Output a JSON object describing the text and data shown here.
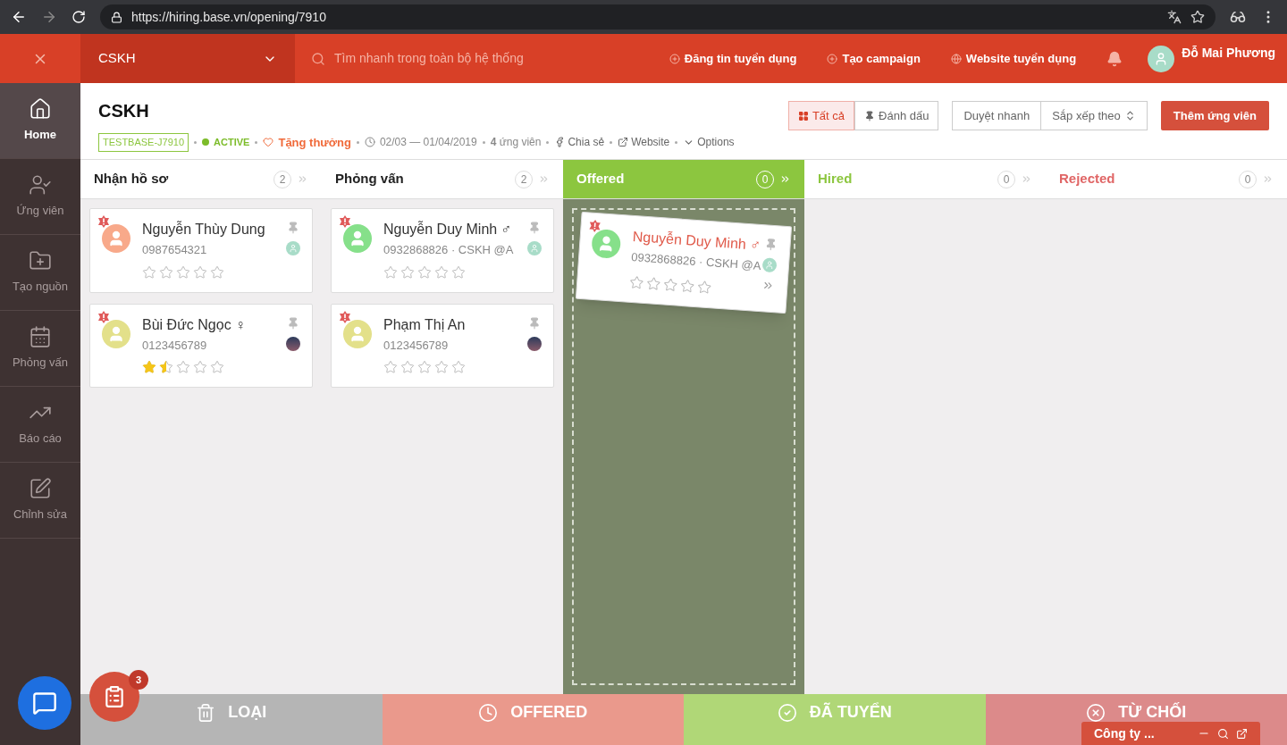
{
  "browser": {
    "url": "https://hiring.base.vn/opening/7910"
  },
  "topbar": {
    "job": "CSKH",
    "search": {
      "placeholder": "Tìm nhanh trong toàn bộ hệ thống"
    },
    "links": [
      "Đăng tin tuyển dụng",
      "Tạo campaign",
      "Website tuyển dụng"
    ],
    "user": "Đỗ Mai Phương"
  },
  "sidebar": {
    "items": [
      {
        "label": "Home",
        "selected": true
      },
      {
        "label": "Ứng viên",
        "selected": false
      },
      {
        "label": "Tạo nguồn",
        "selected": false
      },
      {
        "label": "Phỏng vấn",
        "selected": false
      },
      {
        "label": "Báo cáo",
        "selected": false
      },
      {
        "label": "Chỉnh sửa",
        "selected": false
      }
    ]
  },
  "header": {
    "title": "CSKH",
    "code": "TESTBASE-J7910",
    "status": "ACTIVE",
    "reward": "Tặng thưởng",
    "dates": "02/03 — 01/04/2019",
    "candidates": "**4** ứng viên",
    "share": "Chia sẻ",
    "website": "Website",
    "options": "Options",
    "views": [
      {
        "label": "Tất cả",
        "selected": true
      },
      {
        "label": "Đánh dấu",
        "selected": false
      }
    ],
    "quick": "Duyệt nhanh",
    "sort": "Sắp xếp theo",
    "add": "Thêm ứng viên"
  },
  "columns": [
    {
      "name": "Nhận hồ sơ",
      "count": "2",
      "selected": false,
      "color": "#222222",
      "cards": [
        {
          "name": "Nguyễn Thùy Dung",
          "info": "0987654321",
          "color": "#f8a98a",
          "kind": "user",
          "stars": 0
        },
        {
          "name": "Bùi Đức Ngọc ♀",
          "info": "0123456789",
          "color": "#e3e08a",
          "kind": "photo",
          "stars": 1.5
        }
      ]
    },
    {
      "name": "Phỏng vấn",
      "count": "2",
      "selected": false,
      "color": "#222222",
      "cards": [
        {
          "name": "Nguyễn Duy Minh ♂",
          "info": "0932868826 · CSKH @A",
          "color": "#86e08a",
          "kind": "user",
          "stars": 0
        },
        {
          "name": "Phạm Thị An",
          "info": "0123456789",
          "color": "#e3e08a",
          "kind": "photo",
          "stars": 0
        }
      ]
    },
    {
      "name": "Offered",
      "count": "0",
      "selected": true,
      "color": "#ffffff",
      "dragging": {
        "name": "Nguyễn Duy Minh ♂",
        "info": "0932868826 · CSKH @A",
        "color": "#86e08a",
        "kind": "user",
        "stars": 0
      }
    },
    {
      "name": "Hired",
      "count": "0",
      "selected": false,
      "color": "#8cc63f"
    },
    {
      "name": "Rejected",
      "count": "0",
      "selected": false,
      "color": "#e06666"
    }
  ],
  "drop_actions": [
    {
      "label": "LOẠI",
      "color": "#b5b5b5"
    },
    {
      "label": "OFFERED",
      "color": "#ea998c"
    },
    {
      "label": "ĐÃ TUYỂN",
      "color": "#b0d777"
    },
    {
      "label": "TỪ CHỐI",
      "color": "#dc8a8a"
    }
  ],
  "task_badge": "3",
  "chat_widget": {
    "title": "Công ty ..."
  }
}
